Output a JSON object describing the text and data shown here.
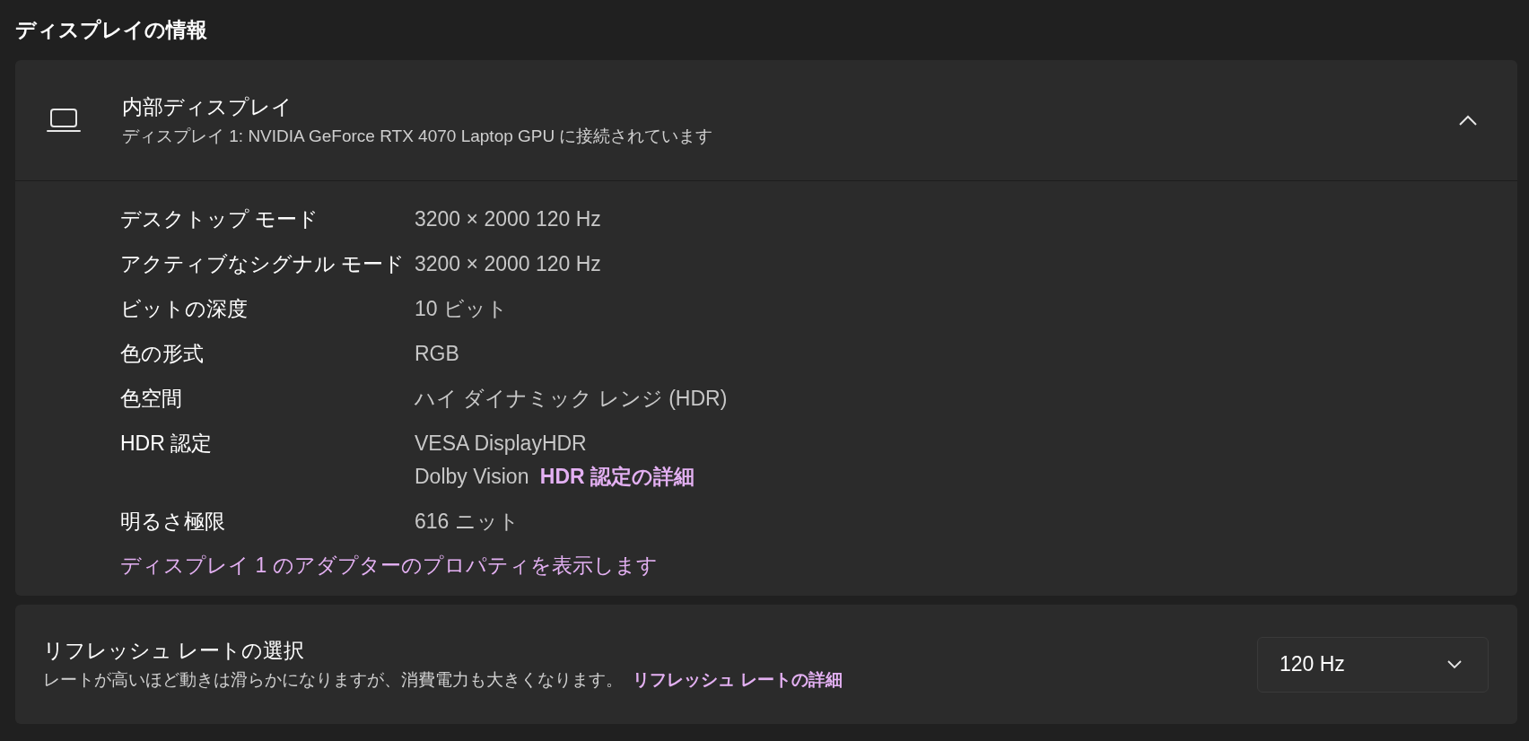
{
  "section_title": "ディスプレイの情報",
  "display_card": {
    "title": "内部ディスプレイ",
    "subtitle": "ディスプレイ 1: NVIDIA GeForce RTX 4070 Laptop GPU に接続されています",
    "expanded": true,
    "properties": [
      {
        "label": "デスクトップ モード",
        "values": [
          "3200 × 2000 120 Hz"
        ]
      },
      {
        "label": "アクティブなシグナル モード",
        "values": [
          "3200 × 2000 120 Hz"
        ]
      },
      {
        "label": "ビットの深度",
        "values": [
          "10 ビット"
        ]
      },
      {
        "label": "色の形式",
        "values": [
          "RGB"
        ]
      },
      {
        "label": "色空間",
        "values": [
          "ハイ ダイナミック レンジ (HDR)"
        ]
      },
      {
        "label": "HDR 認定",
        "values": [
          "VESA DisplayHDR",
          "Dolby Vision"
        ],
        "link": "HDR 認定の詳細"
      },
      {
        "label": "明るさ極限",
        "values": [
          "616 ニット"
        ]
      }
    ],
    "adapter_link": "ディスプレイ 1 のアダプターのプロパティを表示します"
  },
  "refresh_card": {
    "title": "リフレッシュ レートの選択",
    "description": "レートが高いほど動きは滑らかになりますが、消費電力も大きくなります。",
    "link": "リフレッシュ レートの詳細",
    "dropdown": {
      "value": "120 Hz"
    }
  }
}
